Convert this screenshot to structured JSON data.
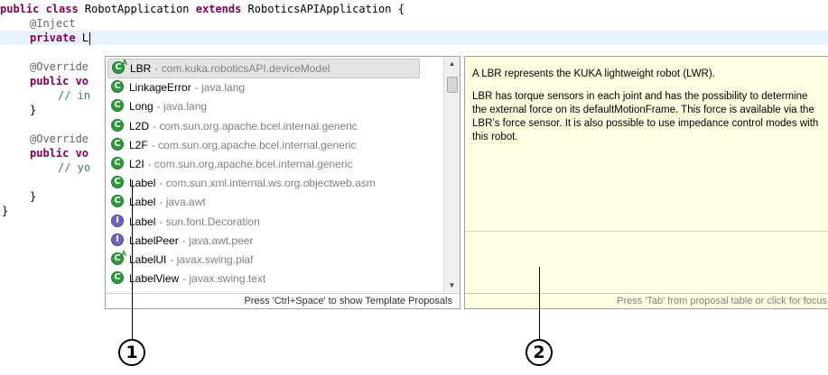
{
  "editor": {
    "line1_kw": "public class",
    "line1_name": " RobotApplication ",
    "line1_kw2": "extends",
    "line1_rest": " RoboticsAPIApplication {",
    "line2_ann": "@Inject",
    "line3_kw": "private",
    "line3_rest": " L",
    "line5_ann": "@Override",
    "line6_kw": "public vo",
    "line7_cmt": "// in",
    "line8": "}",
    "line9_ann": "@Override",
    "line10_kw": "public vo",
    "line11_cmt": "// yo",
    "line13": "}",
    "line14": "}"
  },
  "proposals": {
    "items": [
      {
        "name": "LBR",
        "pkg": "- com.kuka.roboticsAPI.deviceModel",
        "icon": "class-abstract-icon",
        "selected": true
      },
      {
        "name": "LinkageError",
        "pkg": "- java.lang",
        "icon": "class-icon"
      },
      {
        "name": "Long",
        "pkg": "- java.lang",
        "icon": "class-icon"
      },
      {
        "name": "L2D",
        "pkg": "- com.sun.org.apache.bcel.internal.generic",
        "icon": "class-icon"
      },
      {
        "name": "L2F",
        "pkg": "- com.sun.org.apache.bcel.internal.generic",
        "icon": "class-icon"
      },
      {
        "name": "L2I",
        "pkg": "- com.sun.org.apache.bcel.internal.generic",
        "icon": "class-icon"
      },
      {
        "name": "Label",
        "pkg": "- com.sun.xml.internal.ws.org.objectweb.asm",
        "icon": "class-icon"
      },
      {
        "name": "Label",
        "pkg": "- java.awt",
        "icon": "class-icon"
      },
      {
        "name": "Label",
        "pkg": "- sun.font.Decoration",
        "icon": "interface-icon"
      },
      {
        "name": "LabelPeer",
        "pkg": "- java.awt.peer",
        "icon": "interface-icon"
      },
      {
        "name": "LabelUI",
        "pkg": "- javax.swing.plaf",
        "icon": "class-abstract-icon"
      },
      {
        "name": "LabelView",
        "pkg": "- javax.swing.text",
        "icon": "class-icon"
      }
    ],
    "footer": "Press 'Ctrl+Space' to show Template Proposals"
  },
  "doc": {
    "para1": "A LBR represents the KUKA lightweight robot (LWR).",
    "para2": "LBR has torque sensors in each joint and has the possibility to determine the external force on its defaultMotionFrame. This force is available via the LBR’s force sensor. It is also possible to use impedance control modes with this robot.",
    "footer": "Press 'Tab' from proposal table or click for focus"
  },
  "callouts": {
    "one": "1",
    "two": "2"
  }
}
